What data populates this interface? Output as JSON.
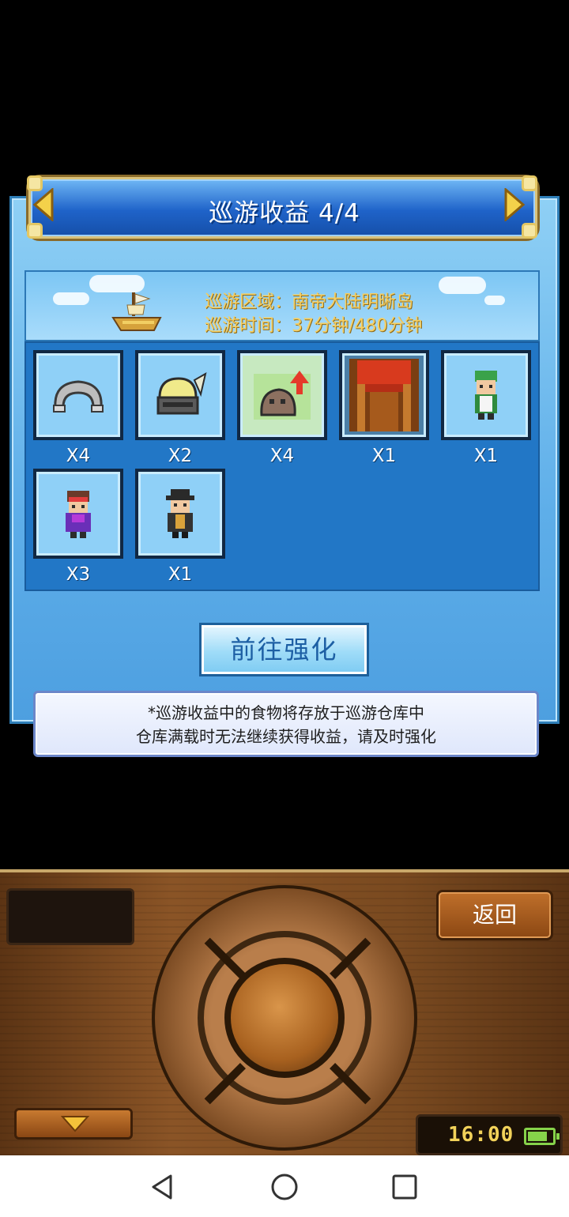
{
  "dialog": {
    "title": "巡游收益 4/4",
    "area_line": "巡游区域：南帝大陆明晰岛",
    "time_line": "巡游时间：37分钟/480分钟",
    "go_button": "前往强化",
    "note_line1": "*巡游收益中的食物将存放于巡游仓库中",
    "note_line2": "仓库满载时无法继续获得收益，请及时强化"
  },
  "rewards": [
    {
      "icon": "crab-claw-icon",
      "qty": "X4"
    },
    {
      "icon": "helmet-icon",
      "qty": "X2"
    },
    {
      "icon": "rock-upgrade-icon",
      "qty": "X4"
    },
    {
      "icon": "red-banner-icon",
      "qty": "X1"
    },
    {
      "icon": "green-hair-character-icon",
      "qty": "X1"
    },
    {
      "icon": "purple-ninja-character-icon",
      "qty": "X3"
    },
    {
      "icon": "black-hat-character-icon",
      "qty": "X1"
    }
  ],
  "controller": {
    "back_button": "返回",
    "clock": "16:00"
  },
  "colors": {
    "title_text": "#ffffff",
    "banner_text": "#f6cf62",
    "accent_blue": "#2277c6"
  }
}
